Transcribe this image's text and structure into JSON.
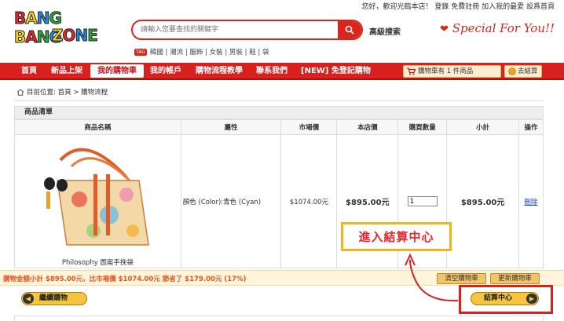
{
  "header": {
    "top_links": "您好，歡迎光臨本店！ 登錄 免費註冊 加入我的最愛 設爲首頁",
    "logo_line1": "BANG BANG",
    "logo_line2": "ZONE",
    "search_placeholder": "請輸入您要查找的關鍵字",
    "advanced_search": "高級搜索",
    "hot_tag": "TAG",
    "hot_tags": "韓國 | 潮流 | 服飾 | 女裝 | 男裝 | 鞋 | 袋",
    "special": "Special For You!!"
  },
  "nav": {
    "items": [
      "首頁",
      "新品上架",
      "我的購物車",
      "我的帳戶",
      "購物流程教學",
      "聯系我們",
      "[NEW] 免登記購物"
    ],
    "cart_info": "購物車有 1 件商品",
    "checkout": "去結算"
  },
  "breadcrumb": "目前位置: 首頁 > 購物流程",
  "cart": {
    "section_title": "商品清單",
    "columns": [
      "商品名稱",
      "屬性",
      "市場價",
      "本店價",
      "購買數量",
      "小計",
      "操作"
    ],
    "row": {
      "name": "Philosophy 圖案手挽袋",
      "attr": "顏色 (Color):青色 (Cyan)",
      "market_price": "$1074.00元",
      "shop_price": "$895.00元",
      "quantity": "1",
      "subtotal": "$895.00元",
      "action": "刪除"
    }
  },
  "callout": "進入結算中心",
  "summary": {
    "text": "購物金額小計 $895.00元，比市場價 $1074.00元 節省了 $179.00元 (17%)",
    "clear_cart": "清空購物車",
    "update_cart": "更新購物車"
  },
  "buttons": {
    "continue": "繼續購物",
    "checkout": "結算中心"
  },
  "colors": {
    "brand_red": "#d7211e",
    "price_orange": "#e8551c",
    "button_gold": "#f5c53e",
    "highlight_red": "#e21d1d"
  }
}
